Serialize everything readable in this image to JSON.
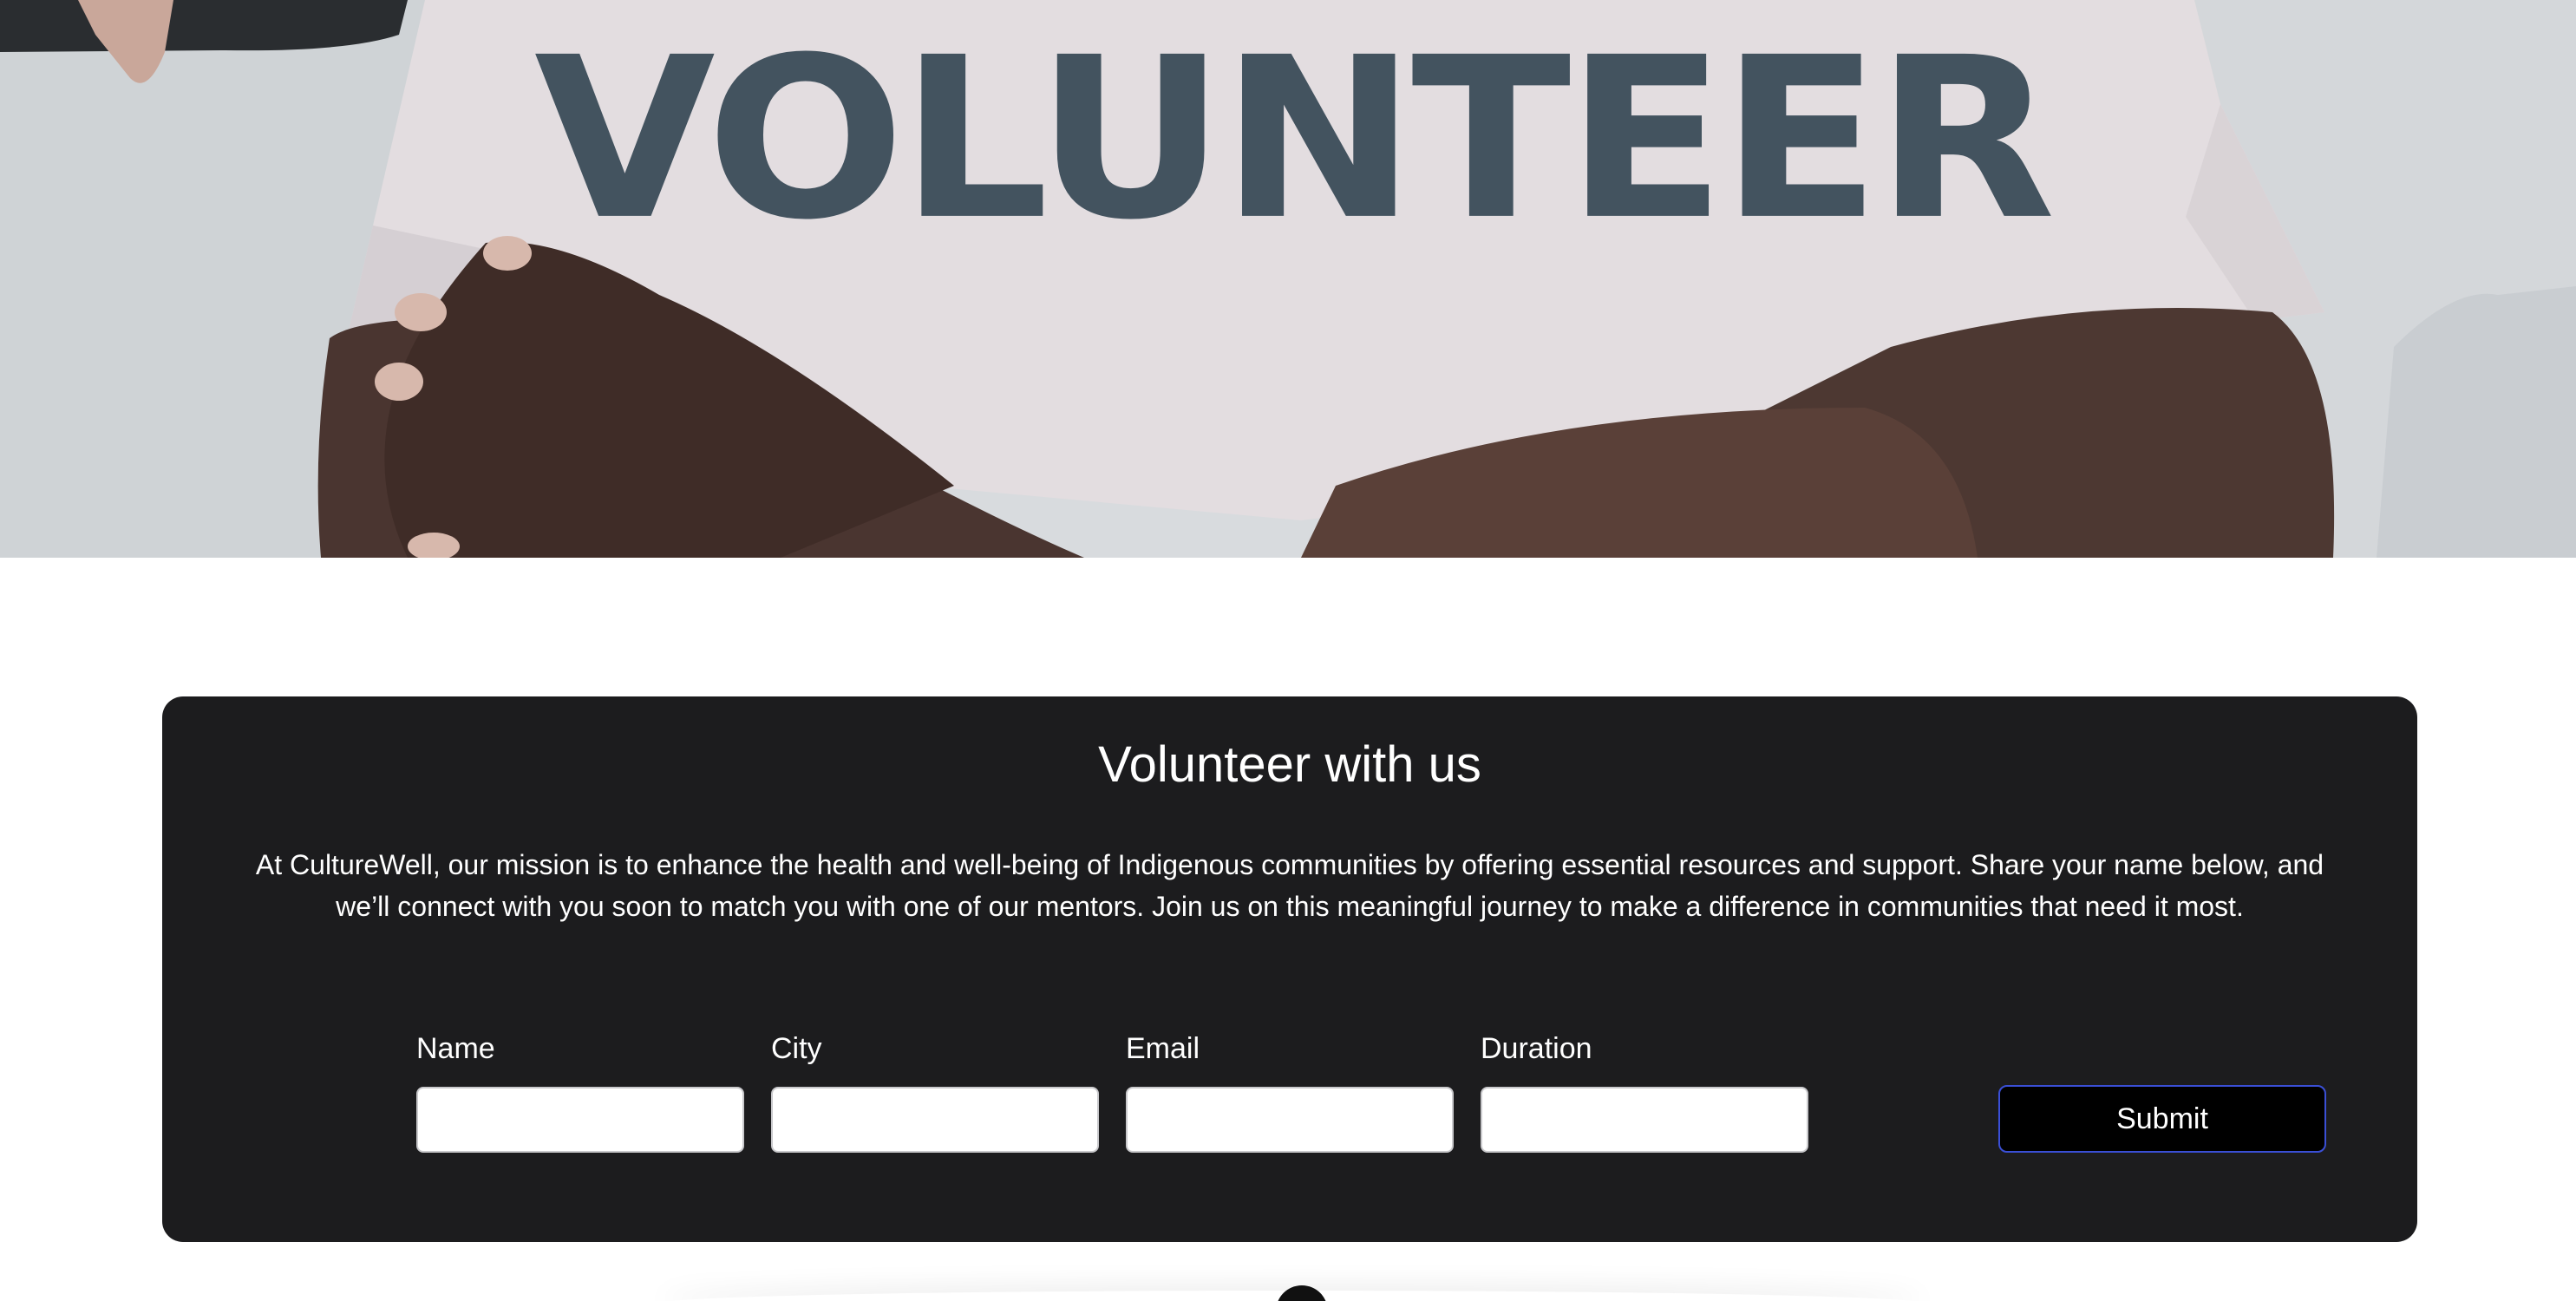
{
  "hero": {
    "shirt_text": "VOLUNTEER"
  },
  "volunteer": {
    "title": "Volunteer with us",
    "description": "At CultureWell, our mission is to enhance the health and well-being of Indigenous communities by offering essential resources and support. Share your name below, and we’ll connect with you soon to match you with one of our mentors. Join us on this meaningful journey to make a difference in communities that need it most.",
    "form": {
      "name_label": "Name",
      "name_value": "",
      "city_label": "City",
      "city_value": "",
      "email_label": "Email",
      "email_value": "",
      "duration_label": "Duration",
      "duration_value": "",
      "submit_label": "Submit"
    }
  },
  "colors": {
    "card_background": "#1c1c1e",
    "submit_border": "#3a4fd6",
    "text": "#ffffff"
  }
}
